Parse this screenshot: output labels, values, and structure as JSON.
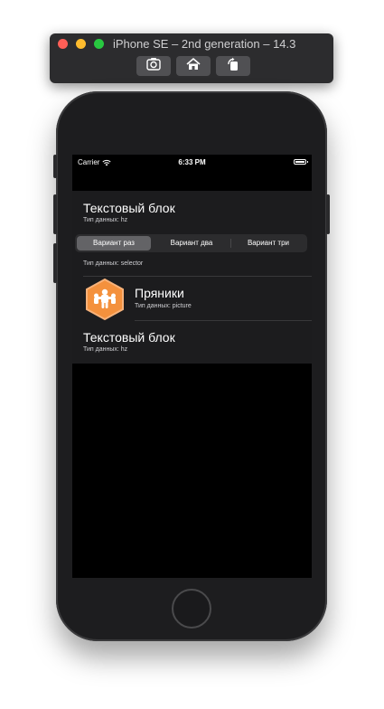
{
  "simulator": {
    "title": "iPhone SE – 2nd generation – 14.3",
    "toolbar_icons": [
      "screenshot-icon",
      "home-icon",
      "rotate-icon"
    ]
  },
  "status_bar": {
    "carrier": "Carrier",
    "time": "6:33 PM"
  },
  "cells": [
    {
      "title": "Текстовый блок",
      "subtitle": "Тип данных: hz"
    },
    {
      "subtitle": "Тип данных: selector"
    },
    {
      "title": "Пряники",
      "subtitle": "Тип данных: picture"
    },
    {
      "title": "Текстовый блок",
      "subtitle": "Тип данных: hz"
    }
  ],
  "selector": {
    "segments": [
      "Вариант раз",
      "Вариант два",
      "Вариант три"
    ],
    "selected_index": 0
  },
  "colors": {
    "background": "#000000",
    "cell_background": "#1c1c1e",
    "segment_selected": "#636366",
    "picture_orange": "#f4913d"
  }
}
